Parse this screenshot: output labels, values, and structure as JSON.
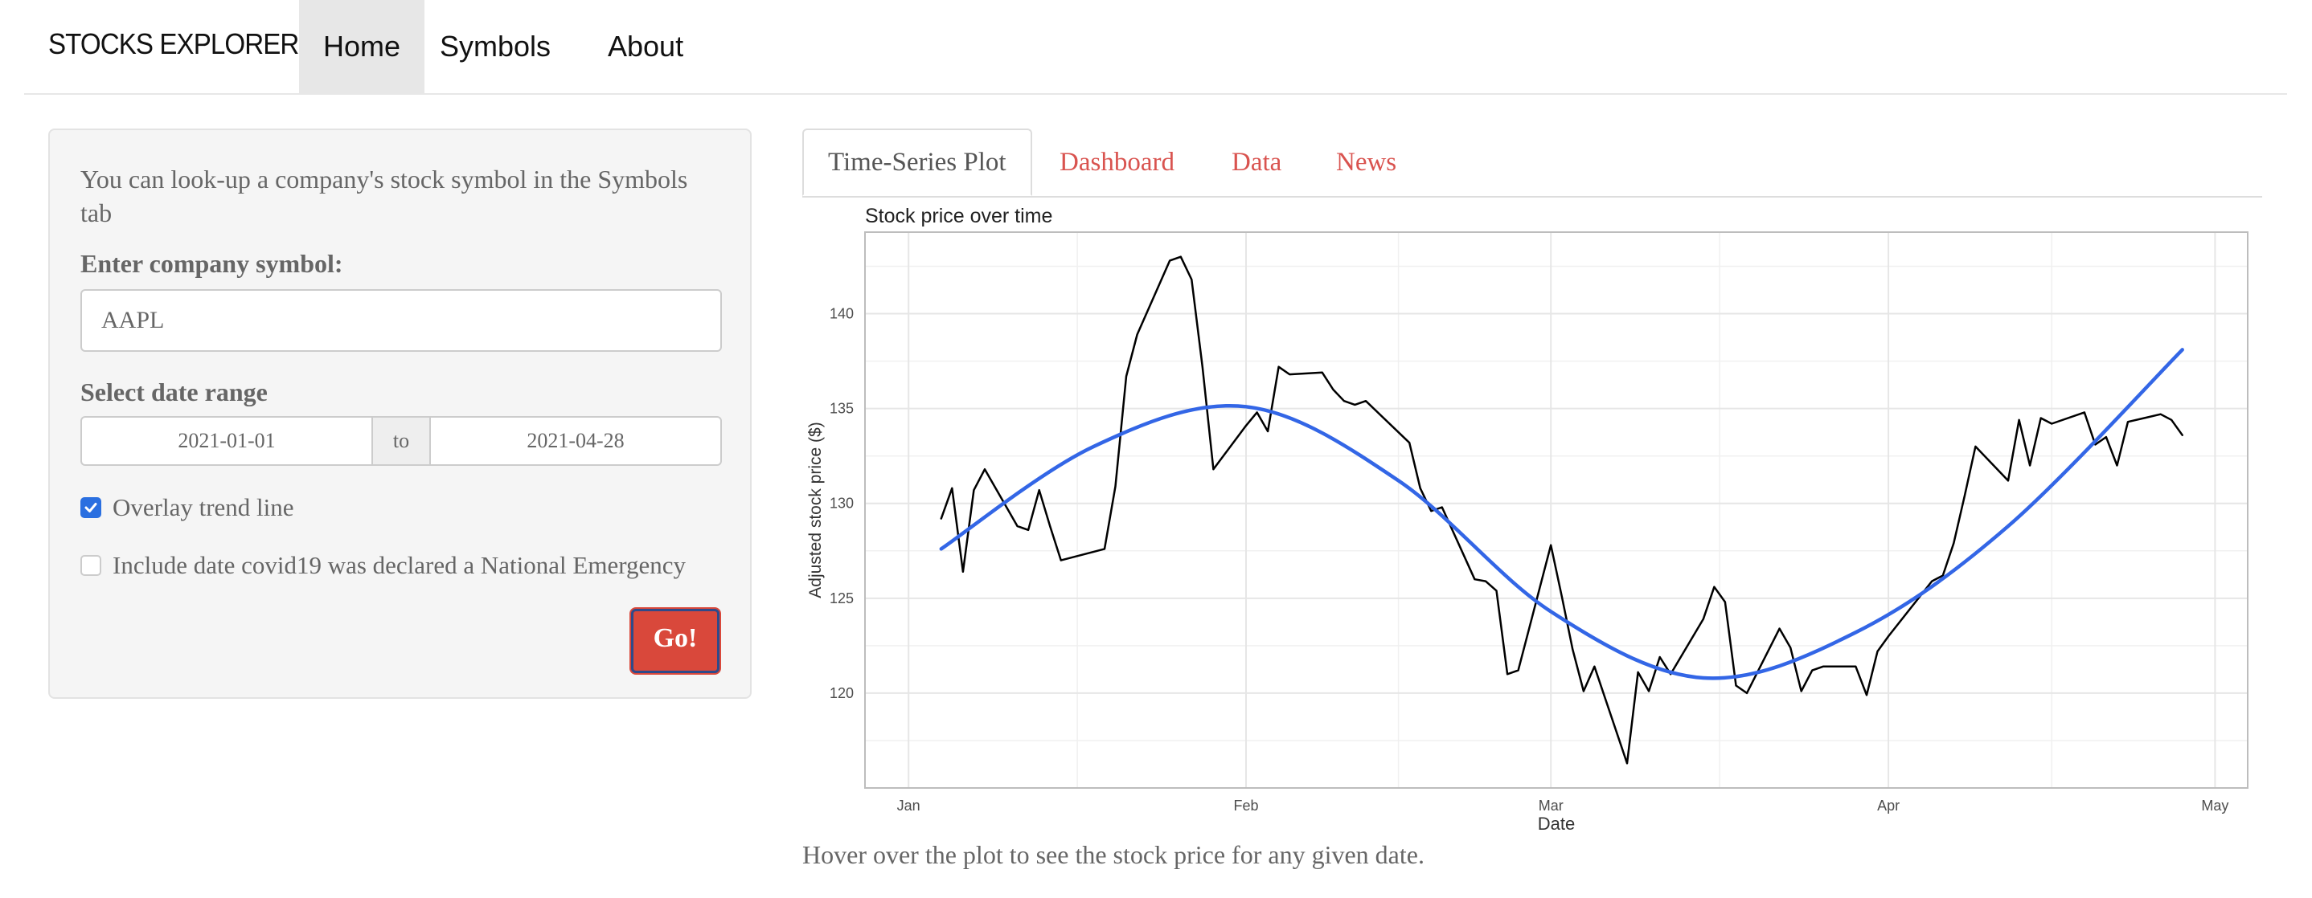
{
  "navbar": {
    "brand": "STOCKS EXPLORER",
    "items": [
      {
        "label": "Home",
        "active": true
      },
      {
        "label": "Symbols",
        "active": false
      },
      {
        "label": "About",
        "active": false
      }
    ]
  },
  "sidebar": {
    "hint": "You can look-up a company's stock symbol in the Symbols tab",
    "symbol_label": "Enter company symbol:",
    "symbol_value": "AAPL",
    "date_label": "Select date range",
    "date_start": "2021-01-01",
    "date_sep": "to",
    "date_end": "2021-04-28",
    "trend_label": "Overlay trend line",
    "trend_checked": true,
    "covid_label": "Include date covid19 was declared a National Emergency",
    "covid_checked": false,
    "go_label": "Go!"
  },
  "tabs": [
    {
      "label": "Time-Series Plot",
      "active": true
    },
    {
      "label": "Dashboard",
      "active": false
    },
    {
      "label": "Data",
      "active": false
    },
    {
      "label": "News",
      "active": false
    }
  ],
  "footer_note": "Hover over the plot to see the stock price for any given date.",
  "colors": {
    "accent": "#d9483b",
    "trend": "#3366e6",
    "price": "#000000",
    "check": "#2a6fe0"
  },
  "chart_data": {
    "type": "line",
    "title": "Stock price over time",
    "xlabel": "Date",
    "ylabel": "Adjusted stock price ($)",
    "x_ticks": [
      "Jan",
      "Feb",
      "Mar",
      "Apr",
      "May"
    ],
    "x_tick_dates": [
      "2021-01-01",
      "2021-02-01",
      "2021-03-01",
      "2021-04-01",
      "2021-05-01"
    ],
    "y_ticks": [
      120,
      125,
      130,
      135,
      140
    ],
    "xlim": [
      "2020-12-28",
      "2021-05-04"
    ],
    "ylim": [
      115,
      144.3
    ],
    "grid": true,
    "series": [
      {
        "name": "",
        "x": [
          "2021-01-04",
          "2021-01-05",
          "2021-01-06",
          "2021-01-07",
          "2021-01-08",
          "2021-01-11",
          "2021-01-12",
          "2021-01-13",
          "2021-01-14",
          "2021-01-15",
          "2021-01-19",
          "2021-01-20",
          "2021-01-21",
          "2021-01-22",
          "2021-01-25",
          "2021-01-26",
          "2021-01-27",
          "2021-01-28",
          "2021-01-29",
          "2021-02-01",
          "2021-02-02",
          "2021-02-03",
          "2021-02-04",
          "2021-02-05",
          "2021-02-08",
          "2021-02-09",
          "2021-02-10",
          "2021-02-11",
          "2021-02-12",
          "2021-02-16",
          "2021-02-17",
          "2021-02-18",
          "2021-02-19",
          "2021-02-22",
          "2021-02-23",
          "2021-02-24",
          "2021-02-25",
          "2021-02-26",
          "2021-03-01",
          "2021-03-02",
          "2021-03-03",
          "2021-03-04",
          "2021-03-05",
          "2021-03-08",
          "2021-03-09",
          "2021-03-10",
          "2021-03-11",
          "2021-03-12",
          "2021-03-15",
          "2021-03-16",
          "2021-03-17",
          "2021-03-18",
          "2021-03-19",
          "2021-03-22",
          "2021-03-23",
          "2021-03-24",
          "2021-03-25",
          "2021-03-26",
          "2021-03-29",
          "2021-03-30",
          "2021-03-31",
          "2021-04-01",
          "2021-04-05",
          "2021-04-06",
          "2021-04-07",
          "2021-04-08",
          "2021-04-09",
          "2021-04-12",
          "2021-04-13",
          "2021-04-14",
          "2021-04-15",
          "2021-04-16",
          "2021-04-19",
          "2021-04-20",
          "2021-04-21",
          "2021-04-22",
          "2021-04-23",
          "2021-04-26",
          "2021-04-27",
          "2021-04-28"
        ],
        "y": [
          129.2,
          130.8,
          126.4,
          130.7,
          131.8,
          128.8,
          128.6,
          130.7,
          128.8,
          127.0,
          127.6,
          130.9,
          136.7,
          138.9,
          142.8,
          143.0,
          141.8,
          137.2,
          131.8,
          134.1,
          134.8,
          133.8,
          137.2,
          136.8,
          136.9,
          136.0,
          135.4,
          135.2,
          135.4,
          133.2,
          130.8,
          129.6,
          129.8,
          126.0,
          125.9,
          125.4,
          121.0,
          121.2,
          127.8,
          125.1,
          122.3,
          120.1,
          121.4,
          116.3,
          121.1,
          120.1,
          121.9,
          121.0,
          123.9,
          125.6,
          124.8,
          120.4,
          120.0,
          123.4,
          122.4,
          120.1,
          121.2,
          121.4,
          121.4,
          119.9,
          122.2,
          123.0,
          125.9,
          126.2,
          127.9,
          130.4,
          133.0,
          131.2,
          134.4,
          132.0,
          134.5,
          134.2,
          134.8,
          133.1,
          133.5,
          132.0,
          134.3,
          134.7,
          134.4,
          133.6
        ]
      },
      {
        "name": "",
        "x": [
          "2021-01-04",
          "2021-01-18",
          "2021-02-01",
          "2021-02-15",
          "2021-03-01",
          "2021-03-15",
          "2021-03-29",
          "2021-04-12",
          "2021-04-28"
        ],
        "y": [
          127.6,
          133.0,
          135.1,
          131.2,
          124.3,
          120.8,
          123.2,
          128.8,
          138.1
        ]
      }
    ]
  }
}
